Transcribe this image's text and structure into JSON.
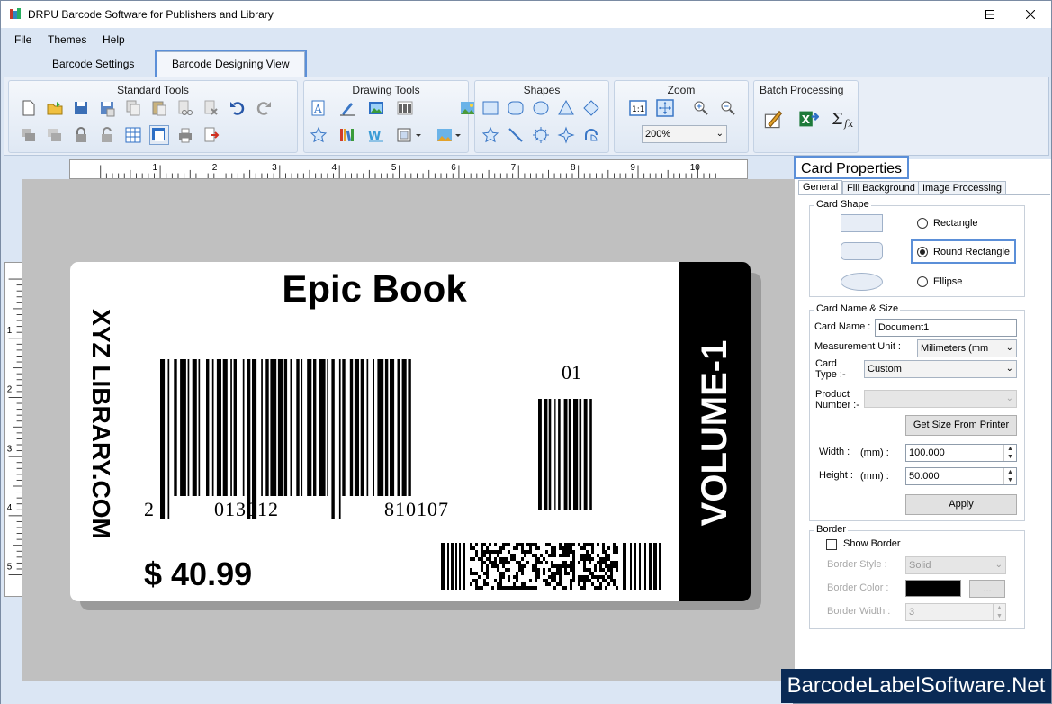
{
  "window": {
    "title": "DRPU Barcode Software for Publishers and Library"
  },
  "menu": {
    "file": "File",
    "themes": "Themes",
    "help": "Help"
  },
  "tabs": {
    "barcode_settings": "Barcode Settings",
    "barcode_designing_view": "Barcode Designing View"
  },
  "ribbon": {
    "standard_tools": "Standard Tools",
    "drawing_tools": "Drawing Tools",
    "shapes": "Shapes",
    "zoom": "Zoom",
    "zoom_value": "200%",
    "batch_processing": "Batch Processing"
  },
  "ruler": {
    "h": [
      "1",
      "2",
      "3",
      "4",
      "5",
      "6",
      "7",
      "8",
      "9",
      "10"
    ],
    "v": [
      "1",
      "2",
      "3",
      "4",
      "5"
    ]
  },
  "label": {
    "title": "Epic Book",
    "side_text": "XYZ LIBRARY.COM",
    "volume": "VOLUME-1",
    "barcode_digit_left": "2",
    "barcode_digits_1": "013012",
    "barcode_digits_2": "810107",
    "addon_digits": "01",
    "price": "$ 40.99"
  },
  "properties": {
    "title": "Card Properties",
    "tabs": {
      "general": "General",
      "fill_background": "Fill Background",
      "image_processing": "Image Processing"
    },
    "card_shape": {
      "legend": "Card Shape",
      "rectangle": "Rectangle",
      "round_rectangle": "Round Rectangle",
      "ellipse": "Ellipse",
      "selected": "Round Rectangle"
    },
    "card_name_size": {
      "legend": "Card  Name & Size",
      "card_name_label": "Card Name :",
      "card_name_value": "Document1",
      "measurement_unit_label": "Measurement Unit :",
      "measurement_unit_value": "Milimeters (mm",
      "card_type_label_1": "Card",
      "card_type_label_2": "Type :-",
      "card_type_value": "Custom",
      "product_number_label_1": "Product",
      "product_number_label_2": "Number :-",
      "get_size_button": "Get Size From Printer",
      "width_label": "Width :",
      "width_unit": "(mm) :",
      "width_value": "100.000",
      "height_label": "Height :",
      "height_unit": "(mm) :",
      "height_value": "50.000",
      "apply_button": "Apply"
    },
    "border": {
      "legend": "Border",
      "show_border": "Show Border",
      "style_label": "Border Style :",
      "style_value": "Solid",
      "color_label": "Border Color :",
      "color_button": "...",
      "width_label": "Border Width :",
      "width_value": "3"
    }
  },
  "watermark": "BarcodeLabelSoftware.Net",
  "colors": {
    "accent": "#5b8fd8",
    "ribbon_bg": "#dbe6f4",
    "canvas": "#c0c0c0"
  }
}
